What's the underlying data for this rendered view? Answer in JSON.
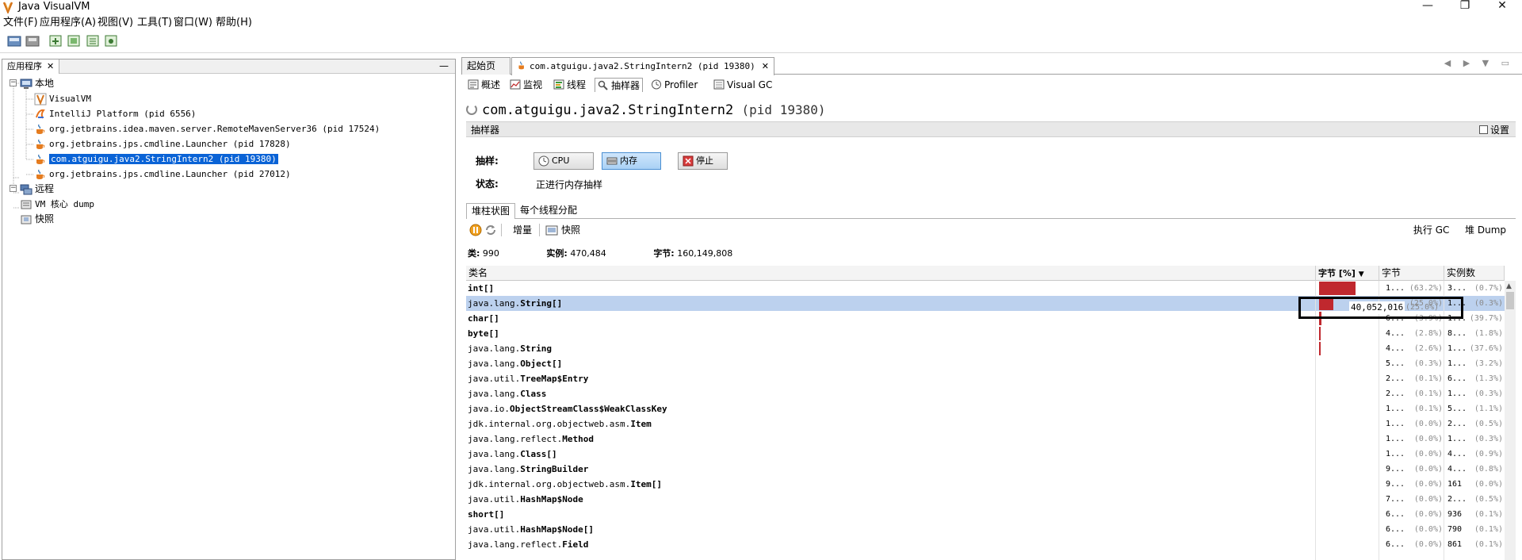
{
  "window": {
    "title": "Java VisualVM",
    "controls": [
      "—",
      "❐",
      "✕"
    ]
  },
  "menubar": [
    "文件(F)",
    "应用程序(A)",
    "视图(V)",
    "工具(T)",
    "窗口(W)",
    "帮助(H)"
  ],
  "left_panel": {
    "tab_label": "应用程序",
    "tree": [
      {
        "label": "本地",
        "icon": "computer-icon",
        "level": 0,
        "expanded": true
      },
      {
        "label": "VisualVM",
        "icon": "visualvm-icon",
        "level": 1
      },
      {
        "label": "IntelliJ Platform (pid 6556)",
        "icon": "intellij-icon",
        "level": 1
      },
      {
        "label": "org.jetbrains.idea.maven.server.RemoteMavenServer36 (pid 17524)",
        "icon": "java-cup-icon",
        "level": 1
      },
      {
        "label": "org.jetbrains.jps.cmdline.Launcher (pid 17828)",
        "icon": "java-cup-icon",
        "level": 1
      },
      {
        "label": "com.atguigu.java2.StringIntern2 (pid 19380)",
        "icon": "java-cup-icon",
        "level": 1,
        "selected": true
      },
      {
        "label": "org.jetbrains.jps.cmdline.Launcher (pid 27012)",
        "icon": "java-cup-icon",
        "level": 1
      },
      {
        "label": "远程",
        "icon": "remote-icon",
        "level": 0,
        "expanded": true
      },
      {
        "label": "VM 核心 dump",
        "icon": "core-dump-icon",
        "level": 0
      },
      {
        "label": "快照",
        "icon": "snapshot-icon",
        "level": 0
      }
    ]
  },
  "tabs": [
    {
      "label": "起始页"
    },
    {
      "label": "com.atguigu.java2.StringIntern2 (pid 19380)",
      "active": true,
      "close": "✕"
    }
  ],
  "nav_arrows": "◀ ▶ ▼ ▭",
  "subtabs": [
    {
      "label": "概述",
      "icon": "overview-icon"
    },
    {
      "label": "监视",
      "icon": "monitor-icon"
    },
    {
      "label": "线程",
      "icon": "threads-icon"
    },
    {
      "label": "抽样器",
      "icon": "sampler-icon",
      "active": true
    },
    {
      "label": "Profiler",
      "icon": "profiler-icon"
    },
    {
      "label": "Visual GC",
      "icon": "visualgc-icon"
    }
  ],
  "process": {
    "name": "com.atguigu.java2.StringIntern2",
    "pid": "(pid 19380)"
  },
  "sampler": {
    "header": "抽样器",
    "settings_label": "设置",
    "sample_label": "抽样:",
    "buttons": {
      "cpu": "CPU",
      "memory": "内存",
      "stop": "停止"
    },
    "status_label": "状态:",
    "status_value": "正进行内存抽样",
    "inner_tabs": [
      "堆柱状图",
      "每个线程分配"
    ],
    "heap_toolbar": {
      "delta": "增量",
      "snapshot": "快照",
      "gc": "执行 GC",
      "heap_dump": "堆 Dump"
    },
    "summary": {
      "classes_label": "类:",
      "classes": "990",
      "instances_label": "实例:",
      "instances": "470,484",
      "bytes_label": "字节:",
      "bytes": "160,149,808"
    }
  },
  "table": {
    "headers": {
      "name": "类名",
      "bytes_pct": "字节 [%]",
      "bytes": "字节",
      "instances": "实例数"
    },
    "rows": [
      {
        "name": "int[]",
        "bar": 0.632,
        "bytes": "1...",
        "bytes_pct": "(63.2%)",
        "inst": "3...",
        "inst_pct": "(0.7%)"
      },
      {
        "name": "java.lang.String[]",
        "bar": 0.25,
        "bytes": "",
        "bytes_pct": "(25.0%)",
        "inst": "1...",
        "inst_pct": "(0.3%)",
        "selected": true
      },
      {
        "name": "char[]",
        "bar": 0.039,
        "bytes": "6...",
        "bytes_pct": "(3.9%)",
        "inst": "1...",
        "inst_pct": "(39.7%)"
      },
      {
        "name": "byte[]",
        "bar": 0.028,
        "bytes": "4...",
        "bytes_pct": "(2.8%)",
        "inst": "8...",
        "inst_pct": "(1.8%)"
      },
      {
        "name": "java.lang.String",
        "bar": 0.026,
        "bytes": "4...",
        "bytes_pct": "(2.6%)",
        "inst": "1...",
        "inst_pct": "(37.6%)"
      },
      {
        "name": "java.lang.Object[]",
        "bar": 0,
        "bytes": "5...",
        "bytes_pct": "(0.3%)",
        "inst": "1...",
        "inst_pct": "(3.2%)"
      },
      {
        "name": "java.util.TreeMap$Entry",
        "bar": 0,
        "bytes": "2...",
        "bytes_pct": "(0.1%)",
        "inst": "6...",
        "inst_pct": "(1.3%)"
      },
      {
        "name": "java.lang.Class",
        "bar": 0,
        "bytes": "2...",
        "bytes_pct": "(0.1%)",
        "inst": "1...",
        "inst_pct": "(0.3%)"
      },
      {
        "name": "java.io.ObjectStreamClass$WeakClassKey",
        "bar": 0,
        "bytes": "1...",
        "bytes_pct": "(0.1%)",
        "inst": "5...",
        "inst_pct": "(1.1%)"
      },
      {
        "name": "jdk.internal.org.objectweb.asm.Item",
        "bar": 0,
        "bytes": "1...",
        "bytes_pct": "(0.0%)",
        "inst": "2...",
        "inst_pct": "(0.5%)"
      },
      {
        "name": "java.lang.reflect.Method",
        "bar": 0,
        "bytes": "1...",
        "bytes_pct": "(0.0%)",
        "inst": "1...",
        "inst_pct": "(0.3%)"
      },
      {
        "name": "java.lang.Class[]",
        "bar": 0,
        "bytes": "1...",
        "bytes_pct": "(0.0%)",
        "inst": "4...",
        "inst_pct": "(0.9%)"
      },
      {
        "name": "java.lang.StringBuilder",
        "bar": 0,
        "bytes": "9...",
        "bytes_pct": "(0.0%)",
        "inst": "4...",
        "inst_pct": "(0.8%)"
      },
      {
        "name": "jdk.internal.org.objectweb.asm.Item[]",
        "bar": 0,
        "bytes": "9...",
        "bytes_pct": "(0.0%)",
        "inst": "161",
        "inst_pct": "(0.0%)"
      },
      {
        "name": "java.util.HashMap$Node",
        "bar": 0,
        "bytes": "7...",
        "bytes_pct": "(0.0%)",
        "inst": "2...",
        "inst_pct": "(0.5%)"
      },
      {
        "name": "short[]",
        "bar": 0,
        "bytes": "6...",
        "bytes_pct": "(0.0%)",
        "inst": "936",
        "inst_pct": "(0.1%)"
      },
      {
        "name": "java.util.HashMap$Node[]",
        "bar": 0,
        "bytes": "6...",
        "bytes_pct": "(0.0%)",
        "inst": "790",
        "inst_pct": "(0.1%)"
      },
      {
        "name": "java.lang.reflect.Field",
        "bar": 0,
        "bytes": "6...",
        "bytes_pct": "(0.0%)",
        "inst": "861",
        "inst_pct": "(0.1%)"
      }
    ],
    "tooltip": {
      "value": "40,052,016",
      "pct": "(25.0%)"
    }
  },
  "colors": {
    "selection": "#0a63d6",
    "row_selected": "#bcd1ee",
    "bar": "#c0282e",
    "active_button": "#a9d1f5"
  }
}
